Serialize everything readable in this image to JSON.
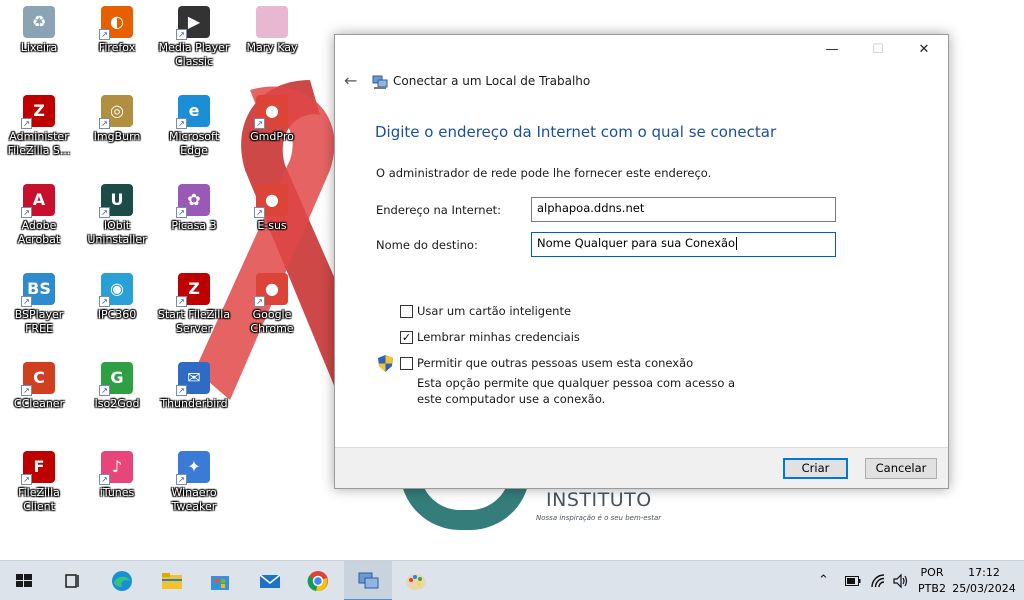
{
  "desktop": {
    "icons": [
      {
        "label": "Lixeira",
        "icon": "recycle-bin-icon",
        "color": "#8aa3b5"
      },
      {
        "label": "Firefox",
        "icon": "firefox-icon",
        "color": "#e66000"
      },
      {
        "label": "Media Player Classic",
        "icon": "media-player-classic-icon",
        "color": "#333333"
      },
      {
        "label": "Mary Kay",
        "icon": "folder-icon",
        "color": "#e8b7d0"
      },
      {
        "label": "Administer FileZilla S...",
        "icon": "filezilla-server-icon",
        "color": "#bf0000"
      },
      {
        "label": "ImgBurn",
        "icon": "imgburn-icon",
        "color": "#b09040"
      },
      {
        "label": "Microsoft Edge",
        "icon": "edge-icon",
        "color": "#1a8fd6"
      },
      {
        "label": "GmdPro",
        "icon": "chrome-icon",
        "color": "#db4437"
      },
      {
        "label": "Adobe Acrobat",
        "icon": "acrobat-icon",
        "color": "#c8102e"
      },
      {
        "label": "IObit Uninstaller",
        "icon": "iobit-uninstaller-icon",
        "color": "#1b4c47"
      },
      {
        "label": "Picasa 3",
        "icon": "picasa-icon",
        "color": "#9b59b6"
      },
      {
        "label": "E-sus",
        "icon": "chrome-icon",
        "color": "#db4437"
      },
      {
        "label": "BSPlayer FREE",
        "icon": "bsplayer-icon",
        "color": "#2e8bd0"
      },
      {
        "label": "IPC360",
        "icon": "ipc360-icon",
        "color": "#2aa0d8"
      },
      {
        "label": "Start FileZilla Server",
        "icon": "filezilla-server-icon",
        "color": "#bf0000"
      },
      {
        "label": "Google Chrome",
        "icon": "chrome-icon",
        "color": "#db4437"
      },
      {
        "label": "CCleaner",
        "icon": "ccleaner-icon",
        "color": "#d04020"
      },
      {
        "label": "Iso2God",
        "icon": "iso2god-icon",
        "color": "#2ea043"
      },
      {
        "label": "Thunderbird",
        "icon": "thunderbird-icon",
        "color": "#2d6bc4"
      },
      {
        "label": "FileZilla Client",
        "icon": "filezilla-client-icon",
        "color": "#bf0000"
      },
      {
        "label": "iTunes",
        "icon": "itunes-icon",
        "color": "#e8457a"
      },
      {
        "label": "Winaero Tweaker",
        "icon": "winaero-tweaker-icon",
        "color": "#3a7bd5"
      }
    ],
    "background_text": {
      "brand": "INSTITUTO",
      "tagline": "Nossa inspiração é o seu bem-estar"
    }
  },
  "dialog": {
    "title": "Conectar a um Local de Trabalho",
    "heading": "Digite o endereço da Internet com o qual se conectar",
    "intro": "O administrador de rede pode lhe fornecer este endereço.",
    "fields": {
      "address_label": "Endereço na Internet:",
      "address_value": "alphapoa.ddns.net",
      "dest_label": "Nome do destino:",
      "dest_value": "Nome Qualquer para sua Conexão"
    },
    "options": [
      {
        "label": "Usar um cartão inteligente",
        "checked": false
      },
      {
        "label": "Lembrar minhas credenciais",
        "checked": true
      },
      {
        "label": "Permitir que outras pessoas usem esta conexão",
        "checked": false
      }
    ],
    "help_text": "Esta opção permite que qualquer pessoa com acesso a este computador use a conexão.",
    "buttons": {
      "create": "Criar",
      "cancel": "Cancelar"
    },
    "window_controls": {
      "minimize": "—",
      "maximize": "☐",
      "close": "✕"
    },
    "check_mark": "✓"
  },
  "taskbar": {
    "items": [
      "windows-start-icon",
      "task-view-icon",
      "edge-icon",
      "file-explorer-icon",
      "microsoft-store-icon",
      "mail-icon",
      "chrome-icon",
      "network-connection-icon",
      "paint-icon"
    ],
    "tray": {
      "language": "POR",
      "layout": "PTB2",
      "time": "17:12",
      "date": "25/03/2024"
    }
  },
  "colors": {
    "accent": "#0078d7",
    "heading_blue": "#1a4f9c",
    "ribbon": "#c62828"
  }
}
